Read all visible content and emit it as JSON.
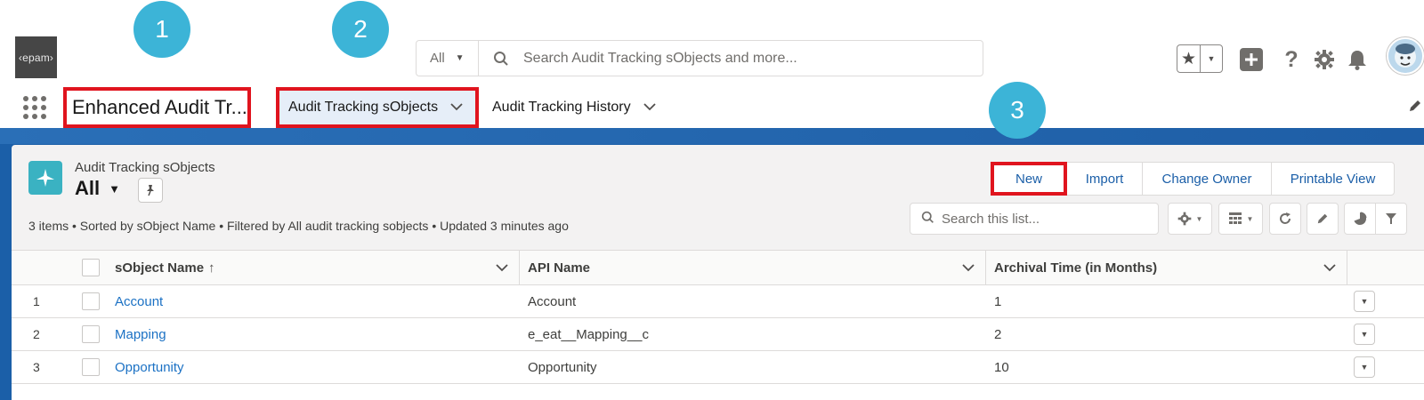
{
  "header": {
    "logo_text": "‹epam›",
    "search_scope": "All",
    "search_placeholder": "Search Audit Tracking sObjects and more..."
  },
  "nav": {
    "app_name": "Enhanced Audit Tr...",
    "tabs": [
      {
        "label": "Audit Tracking sObjects",
        "active": true
      },
      {
        "label": "Audit Tracking History",
        "active": false
      }
    ]
  },
  "badges": [
    "1",
    "2",
    "3"
  ],
  "list_view": {
    "object_label": "Audit Tracking sObjects",
    "view_name": "All",
    "meta": "3 items • Sorted by sObject Name • Filtered by All audit tracking sobjects • Updated 3 minutes ago",
    "buttons": [
      "New",
      "Import",
      "Change Owner",
      "Printable View"
    ],
    "search_placeholder": "Search this list..."
  },
  "table": {
    "columns": [
      "sObject Name",
      "API Name",
      "Archival Time (in Months)"
    ],
    "sort_indicator": "↑",
    "rows": [
      {
        "num": "1",
        "name": "Account",
        "api": "Account",
        "months": "1"
      },
      {
        "num": "2",
        "name": "Mapping",
        "api": "e_eat__Mapping__c",
        "months": "2"
      },
      {
        "num": "3",
        "name": "Opportunity",
        "api": "Opportunity",
        "months": "10"
      }
    ]
  },
  "colors": {
    "accent": "#1b5fa8",
    "highlight_border": "#e0141e",
    "badge": "#3cb4d7",
    "object_icon": "#3ab2c2"
  },
  "icons": [
    "search-icon",
    "star-icon",
    "plus-icon",
    "help-icon",
    "gear-icon",
    "bell-icon",
    "waffle-icon",
    "pin-icon",
    "refresh-icon",
    "pencil-icon",
    "chart-icon",
    "filter-icon"
  ]
}
